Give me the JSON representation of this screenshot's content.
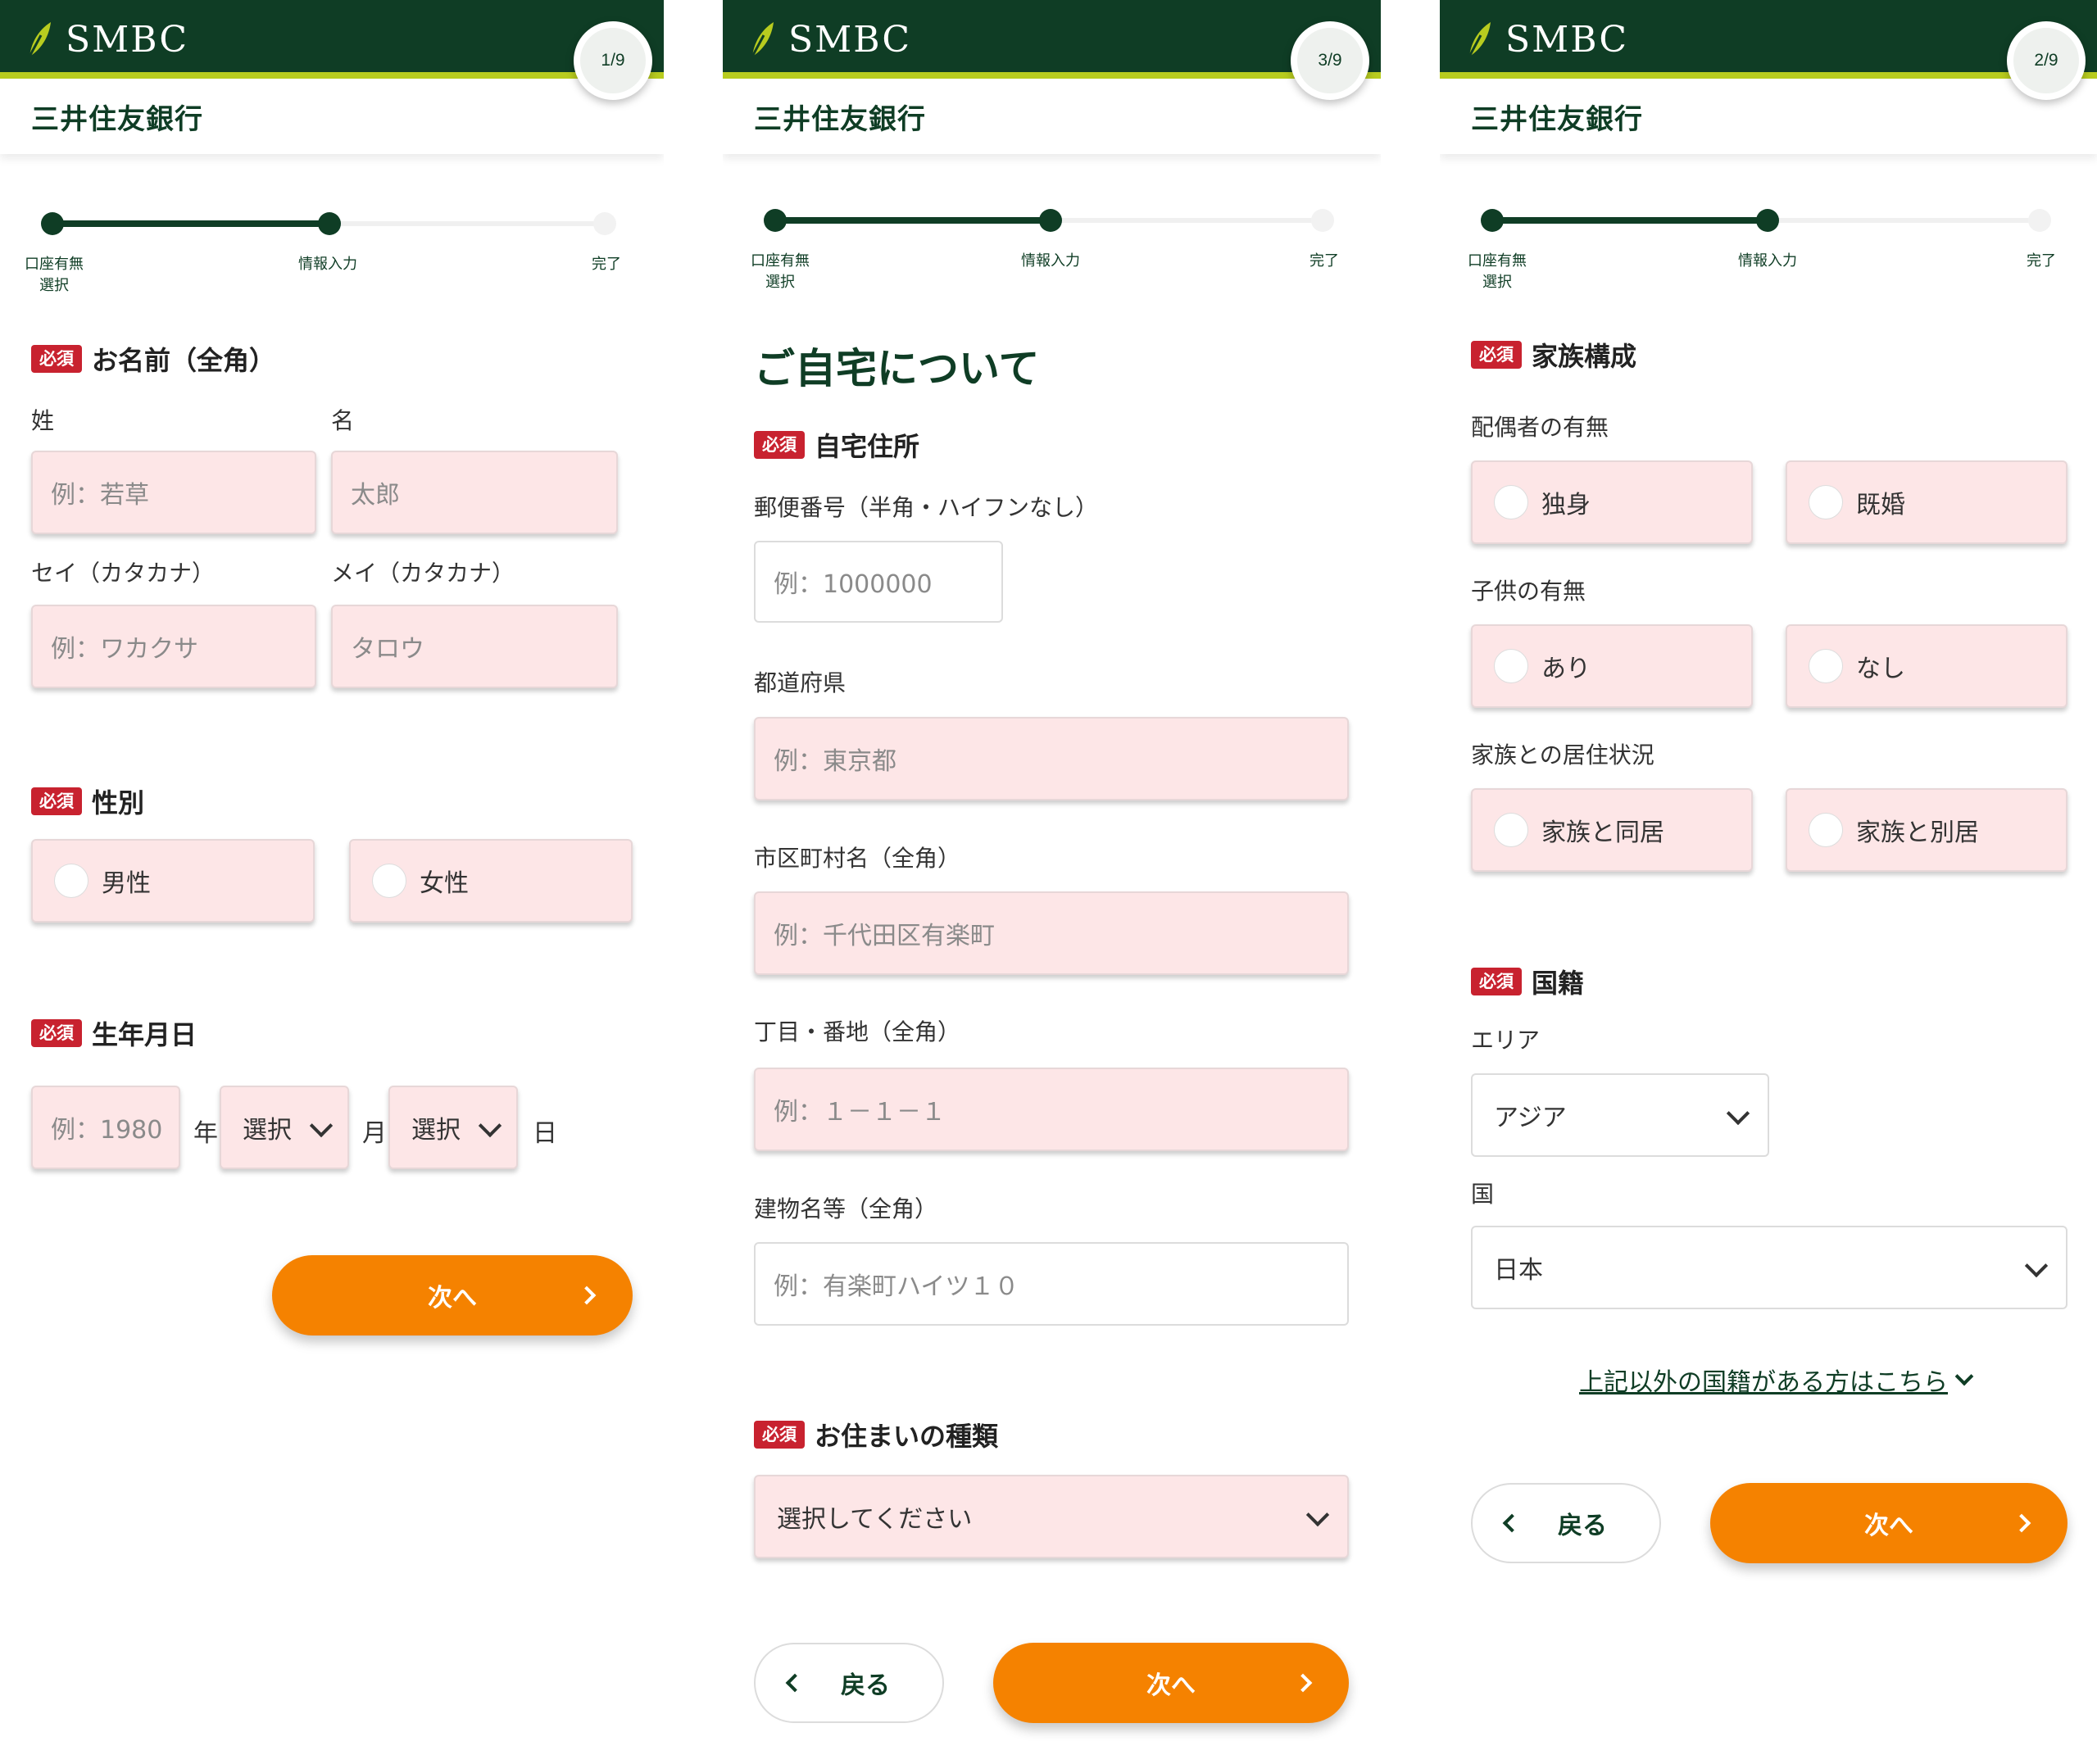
{
  "brand": {
    "logo_text": "SMBC",
    "bank_name": "三井住友銀行"
  },
  "progress_labels": {
    "step1": "口座有無\n選択",
    "step2": "情報入力",
    "step3": "完了"
  },
  "colors": {
    "header": "#0f3d25",
    "accent_line": "#b8cc1f",
    "field_bg": "#fde6e7",
    "required": "#c8222f",
    "primary_button": "#f58200"
  },
  "required_badge": "必須",
  "panel1": {
    "step": "1/9",
    "name_section": "お名前（全角）",
    "last_name_label": "姓",
    "first_name_label": "名",
    "last_name_placeholder": "例：若草",
    "first_name_placeholder": "太郎",
    "last_kana_label": "セイ（カタカナ）",
    "first_kana_label": "メイ（カタカナ）",
    "last_kana_placeholder": "例：ワカクサ",
    "first_kana_placeholder": "タロウ",
    "gender_section": "性別",
    "gender_options": [
      "男性",
      "女性"
    ],
    "birth_section": "生年月日",
    "year_placeholder": "例：1980",
    "year_unit": "年",
    "month_value": "選択",
    "month_unit": "月",
    "day_value": "選択",
    "day_unit": "日",
    "next_label": "次へ"
  },
  "panel2": {
    "step": "3/9",
    "page_title": "ご自宅について",
    "address_section": "自宅住所",
    "postal_label": "郵便番号（半角・ハイフンなし）",
    "postal_placeholder": "例：1000000",
    "pref_label": "都道府県",
    "pref_placeholder": "例：東京都",
    "city_label": "市区町村名（全角）",
    "city_placeholder": "例：千代田区有楽町",
    "block_label": "丁目・番地（全角）",
    "block_placeholder": "例：１－１－１",
    "building_label": "建物名等（全角）",
    "building_placeholder": "例：有楽町ハイツ１０",
    "housing_section": "お住まいの種類",
    "housing_value": "選択してください",
    "back_label": "戻る",
    "next_label": "次へ"
  },
  "panel3": {
    "step": "2/9",
    "family_section": "家族構成",
    "spouse_label": "配偶者の有無",
    "spouse_options": [
      "独身",
      "既婚"
    ],
    "children_label": "子供の有無",
    "children_options": [
      "あり",
      "なし"
    ],
    "living_label": "家族との居住状況",
    "living_options": [
      "家族と同居",
      "家族と別居"
    ],
    "nationality_section": "国籍",
    "area_label": "エリア",
    "area_value": "アジア",
    "country_label": "国",
    "country_value": "日本",
    "other_link": "上記以外の国籍がある方はこちら",
    "back_label": "戻る",
    "next_label": "次へ"
  }
}
